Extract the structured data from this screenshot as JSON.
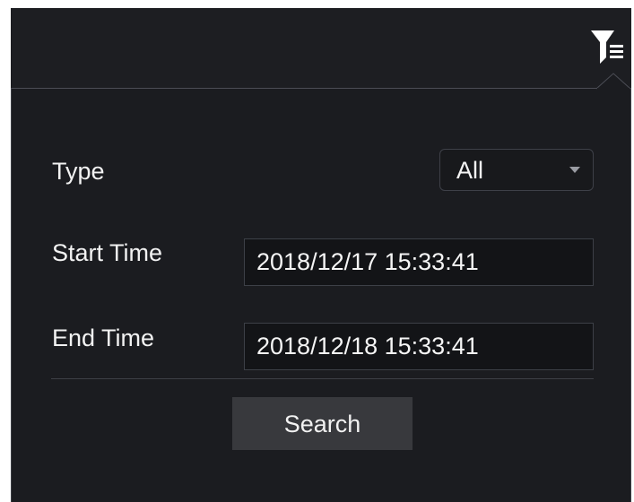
{
  "toolbar": {
    "filter_icon": "filter-list-icon"
  },
  "filter_panel": {
    "type_label": "Type",
    "type_value": "All",
    "start_time_label": "Start Time",
    "start_time_value": "2018/12/17 15:33:41",
    "end_time_label": "End Time",
    "end_time_value": "2018/12/18 15:33:41",
    "search_label": "Search"
  },
  "colors": {
    "background": "#1d1e22",
    "panel_background": "#1b1c20",
    "input_background": "#131417",
    "button_background": "#38393d",
    "text": "#f2f2f2",
    "border": "#3d3f46"
  }
}
